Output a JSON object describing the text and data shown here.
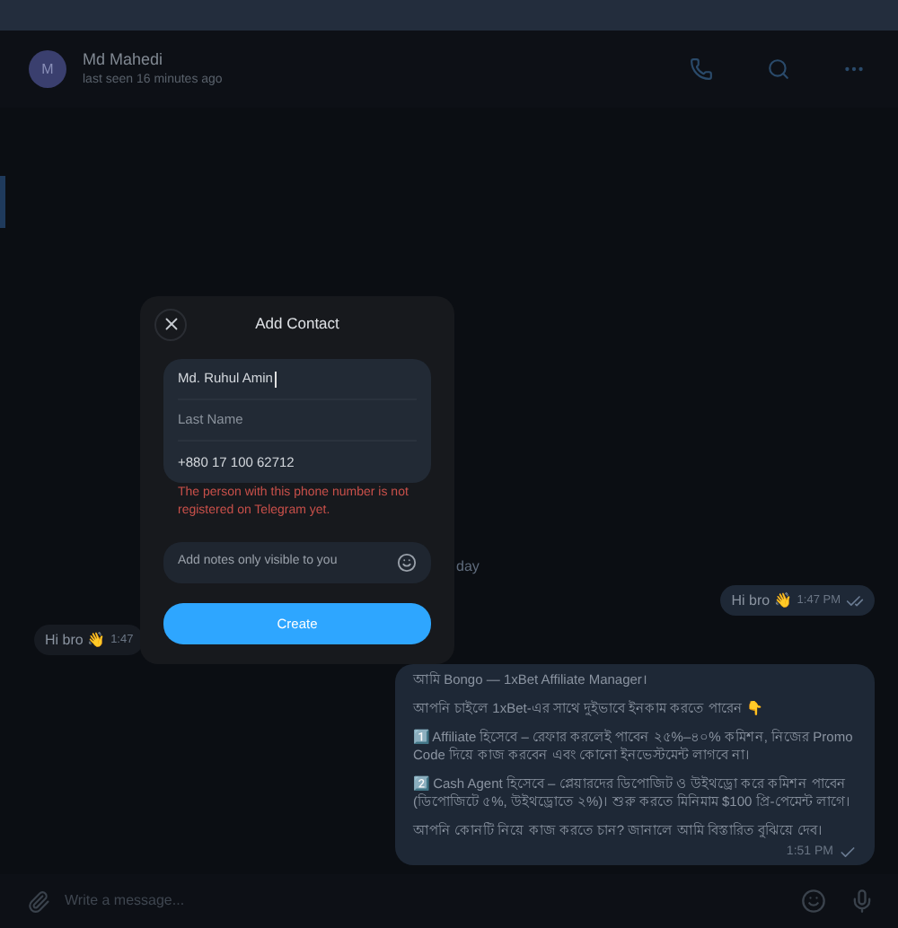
{
  "header": {
    "avatar_letter": "M",
    "name": "Md Mahedi",
    "status": "last seen 16 minutes ago"
  },
  "date_chip": "day",
  "messages": [
    {
      "kind": "outgoing",
      "text": "Hi bro 👋",
      "time": "1:47 PM",
      "read": true
    },
    {
      "kind": "incoming",
      "text": "Hi bro 👋",
      "time": "1:47"
    },
    {
      "kind": "outgoing",
      "paragraphs": [
        "আমি Bongo — 1xBet Affiliate Manager।",
        "আপনি চাইলে 1xBet-এর সাথে দুইভাবে ইনকাম করতে পারেন 👇",
        "1️⃣ Affiliate হিসেবে – রেফার করলেই পাবেন ২৫%–৪০% কমিশন, নিজের Promo Code দিয়ে কাজ করবেন এবং কোনো ইনভেস্টমেন্ট লাগবে না।",
        "2️⃣ Cash Agent হিসেবে – প্লেয়ারদের ডিপোজিট ও উইথড্রো করে কমিশন পাবেন (ডিপোজিটে ৫%, উইথড্রোতে ২%)। শুরু করতে মিনিমাম $100 প্রি-পেমেন্ট লাগে।",
        "আপনি কোনটি নিয়ে কাজ করতে চান? জানালে আমি বিস্তারিত বুঝিয়ে দেব।"
      ],
      "time": "1:51 PM",
      "read": false
    }
  ],
  "composer": {
    "placeholder": "Write a message..."
  },
  "dialog": {
    "title": "Add Contact",
    "fields": [
      {
        "value": "Md. Ruhul Amin",
        "focused": true
      },
      {
        "placeholder": "Last Name"
      },
      {
        "value": "+880 17 100 62712",
        "focused": false
      }
    ],
    "error": "The person with this phone number is not registered on Telegram yet.",
    "notes": {
      "placeholder": "Add notes only visible to you"
    },
    "button": "Create"
  }
}
